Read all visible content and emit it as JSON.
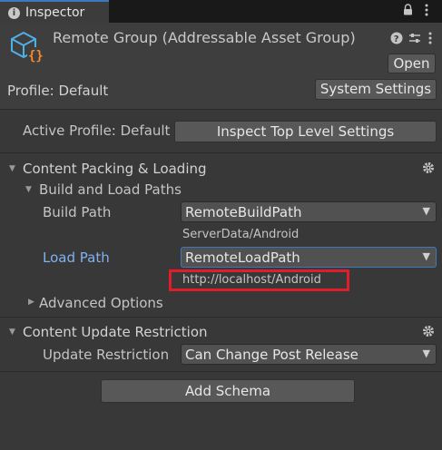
{
  "tab": {
    "title": "Inspector"
  },
  "header": {
    "title": "Remote Group (Addressable Asset Group)",
    "open_label": "Open",
    "profile_label": "Profile: Default",
    "system_settings_label": "System Settings"
  },
  "active_profile": {
    "label": "Active Profile: Default",
    "button_label": "Inspect Top Level Settings"
  },
  "content_packing": {
    "title": "Content Packing & Loading",
    "build_load_paths": {
      "title": "Build and Load Paths",
      "build_path_label": "Build Path",
      "build_path_value": "RemoteBuildPath",
      "build_path_resolved": "ServerData/Android",
      "load_path_label": "Load Path",
      "load_path_value": "RemoteLoadPath",
      "load_path_resolved": "http://localhost/Android"
    },
    "advanced_options": "Advanced Options"
  },
  "content_update": {
    "title": "Content Update Restriction",
    "update_restriction_label": "Update Restriction",
    "update_restriction_value": "Can Change Post Release"
  },
  "add_schema_label": "Add Schema",
  "colors": {
    "accent_blue": "#3a79bb",
    "link_label": "#7fb2f0",
    "highlight_red": "#e11d2b",
    "icon_orange": "#f58a2e",
    "icon_blue": "#4fb0e8"
  },
  "icons": [
    "info-icon",
    "lock-icon",
    "kebab-menu-icon",
    "help-icon",
    "preset-icon",
    "gear-icon",
    "triangle-down-icon",
    "triangle-right-icon"
  ]
}
